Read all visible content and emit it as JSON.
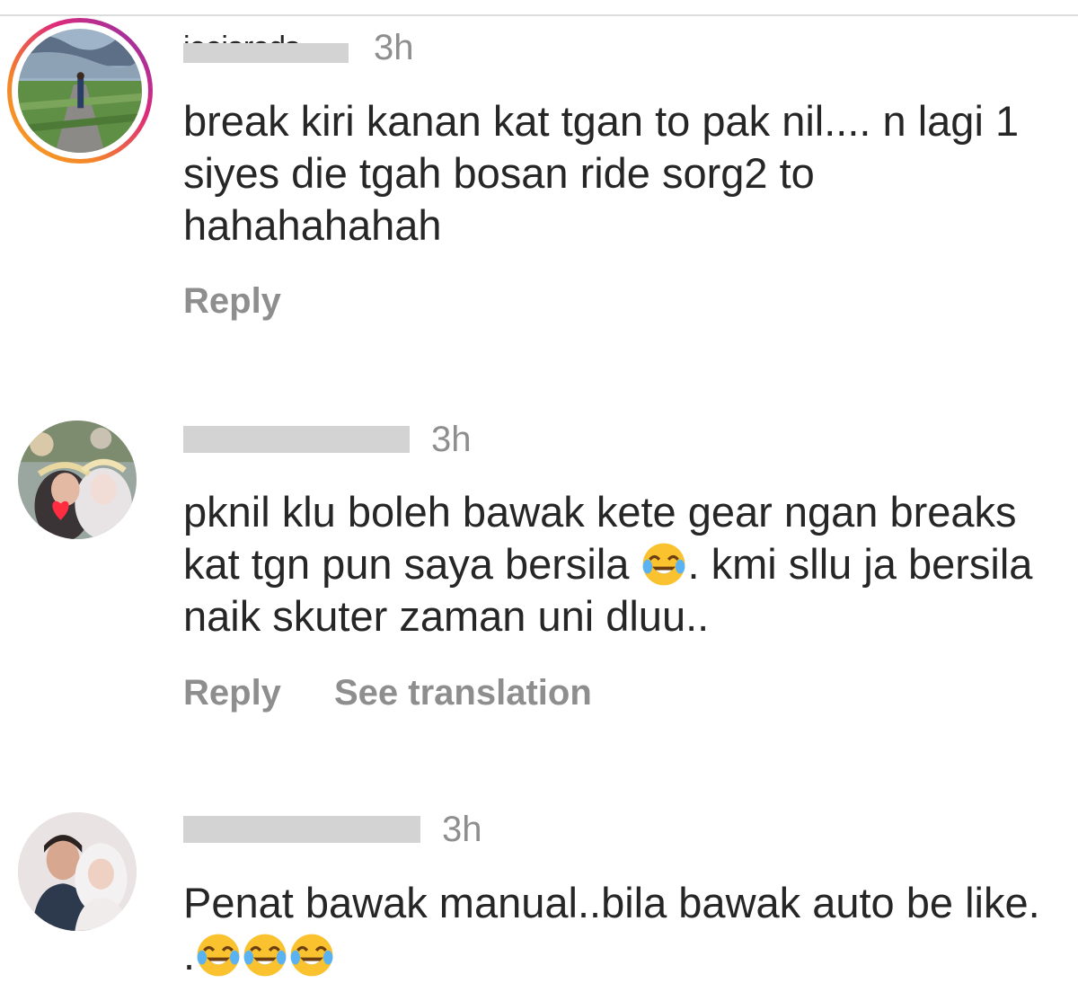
{
  "comments": [
    {
      "username_fragment": "jeejareds",
      "time": "3h",
      "text": "break kiri kanan kat tgan to pak nil.... n lagi 1 siyes die tgah bosan ride sorg2 to hahahahahah",
      "actions": {
        "reply": "Reply"
      },
      "has_story_ring": true
    },
    {
      "time": "3h",
      "text_before_emoji": "pknil klu boleh bawak kete gear ngan breaks kat tgn pun saya bersila ",
      "text_after_emoji": ". kmi sllu ja bersila naik skuter zaman uni dluu..",
      "emoji": "face-with-tears-of-joy",
      "actions": {
        "reply": "Reply",
        "see_translation": "See translation"
      }
    },
    {
      "time": "3h",
      "text": "Penat bawak manual..bila bawak auto be like. .",
      "emoji": "face-with-tears-of-joy",
      "emoji_count": 3
    }
  ],
  "colors": {
    "text": "#262626",
    "secondary": "#8e8e8e",
    "redaction": "#d3d3d3",
    "story_ring_start": "#f5a623",
    "story_ring_end": "#8134af"
  }
}
